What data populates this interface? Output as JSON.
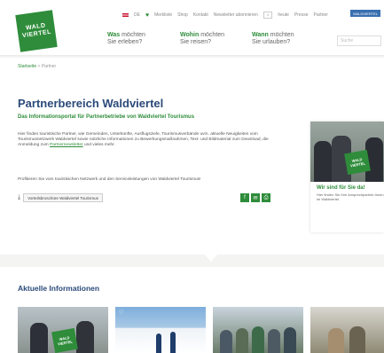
{
  "header": {
    "logo_line1": "WALD",
    "logo_line2": "VIERTEL",
    "topbar": {
      "language": "DE",
      "merkliste": "Merkliste",
      "shop": "Shop",
      "kontakt": "Kontakt",
      "newsletter": "Newsletter abonnieren",
      "weather_icon": "sun-icon",
      "temperature": "heute",
      "presse": "Presse",
      "partner": "Partner",
      "button": "WALDVIERTEL"
    },
    "nav": [
      {
        "bold": "Was",
        "rest": " möchten",
        "line2": "Sie erleben?"
      },
      {
        "bold": "Wohin",
        "rest": " möchten",
        "line2": "Sie reisen?"
      },
      {
        "bold": "Wann",
        "rest": " möchten",
        "line2": "Sie urlauben?"
      }
    ],
    "search_placeholder": "Suche"
  },
  "breadcrumb": {
    "home": "Startseite",
    "sep": ">",
    "current": "Partner"
  },
  "main": {
    "title": "Partnerbereich Waldviertel",
    "subtitle": "Das Informationsportal für Partnerbetriebe von Waldviertel Tourismus",
    "paragraph1": "Hier finden touristische Partner, wie Gemeinden, Unterkünfte, Ausflugsziele, Tourismusverbände uvm. aktuelle Neuigkeiten vom Tourismusnetzwerk Waldviertel sowie nützliche Informationen zu Bewerbungsmaßnahmen, Text- und Bildmaterial zum Download, die Anmeldung zum",
    "paragraph1_link": "Partnernewsletter",
    "paragraph1_end": "und vieles mehr.",
    "paragraph2": "Profitieren Sie vom touristischen Netzwerk und den Serviceleistungen von Waldviertel Tourismus!",
    "download_label": "Vorteilsbroschüre Waldviertel Tourismus",
    "share_icons": [
      "facebook-icon",
      "email-icon",
      "print-icon"
    ]
  },
  "card": {
    "title": "Wir sind für Sie da!",
    "text": "Hier finden Sie Ihre Ansprechpartner:innen im Waldviertel.",
    "sign_line1": "WALD",
    "sign_line2": "VIERTEL"
  },
  "news": {
    "heading": "Aktuelle Informationen",
    "tiles": [
      {
        "icon": "",
        "sign1": "WALD",
        "sign2": "VIERTEL"
      },
      {
        "icon": "♡"
      },
      {
        "icon": ""
      },
      {
        "icon": ""
      }
    ]
  },
  "colors": {
    "brand_green": "#2e8c3a",
    "heading_blue": "#2b4a7a"
  }
}
